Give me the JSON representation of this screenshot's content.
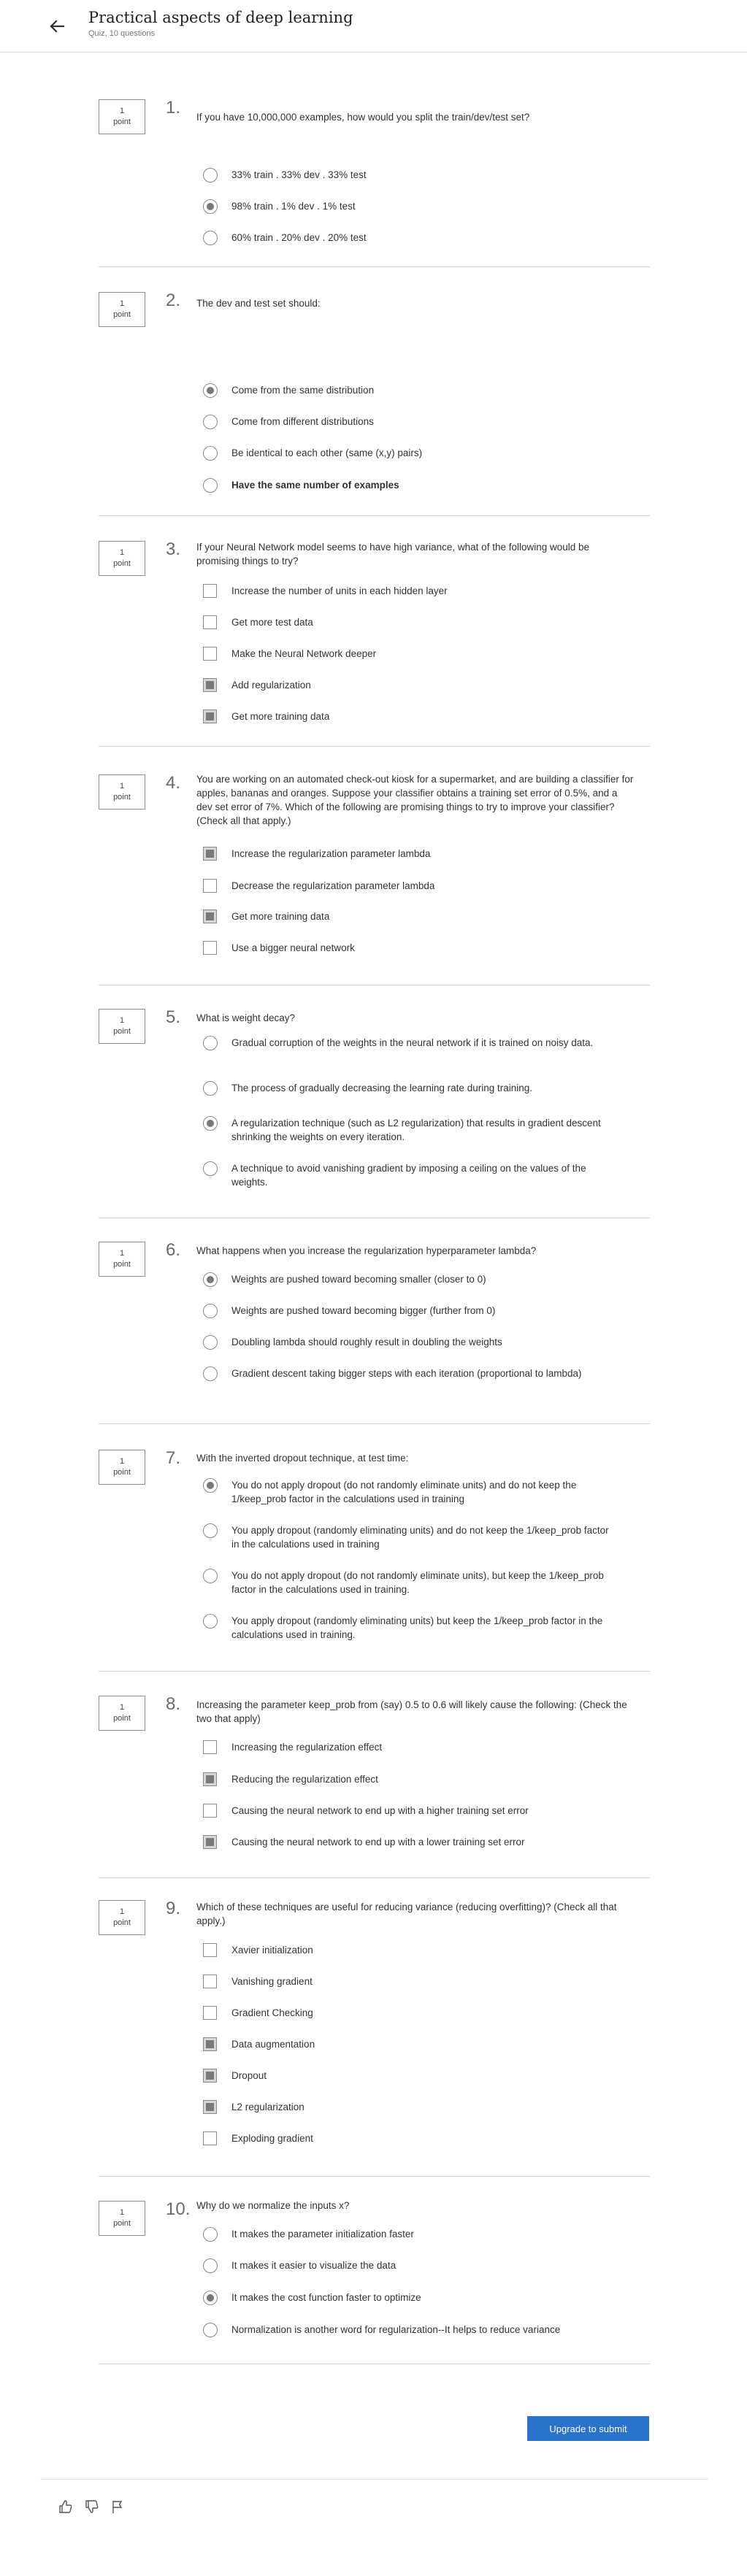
{
  "header": {
    "title": "Practical aspects of deep learning",
    "subtitle": "Quiz, 10 questions"
  },
  "points_label": {
    "value": "1",
    "unit": "point"
  },
  "questions": [
    {
      "number": "1.",
      "type": "radio",
      "text": "If you have 10,000,000 examples, how would you split the train/dev/test set?",
      "options": [
        {
          "label": "33% train . 33% dev . 33% test",
          "selected": false
        },
        {
          "label": "98% train . 1% dev . 1% test",
          "selected": true
        },
        {
          "label": "60% train . 20% dev . 20% test",
          "selected": false
        }
      ]
    },
    {
      "number": "2.",
      "type": "radio",
      "text": "The dev and test set should:",
      "options": [
        {
          "label": "Come from the same distribution",
          "selected": true
        },
        {
          "label": "Come from different distributions",
          "selected": false
        },
        {
          "label": "Be identical to each other (same (x,y) pairs)",
          "selected": false
        },
        {
          "label": "Have the same number of examples",
          "selected": false
        }
      ]
    },
    {
      "number": "3.",
      "type": "checkbox",
      "text": "If your Neural Network model seems to have high variance, what of the following would be promising things to try?",
      "options": [
        {
          "label": "Increase the number of units in each hidden layer",
          "selected": false
        },
        {
          "label": "Get more test data",
          "selected": false
        },
        {
          "label": "Make the Neural Network deeper",
          "selected": false
        },
        {
          "label": "Add regularization",
          "selected": true
        },
        {
          "label": "Get more training data",
          "selected": true
        }
      ]
    },
    {
      "number": "4.",
      "type": "checkbox",
      "text": "You are working on an automated check-out kiosk for a supermarket, and are building a classifier for apples, bananas and oranges. Suppose your classifier obtains a training set error of 0.5%, and a dev set error of 7%. Which of the following are promising things to try to improve your classifier? (Check all that apply.)",
      "options": [
        {
          "label": "Increase the regularization parameter lambda",
          "selected": true
        },
        {
          "label": "Decrease the regularization parameter lambda",
          "selected": false
        },
        {
          "label": "Get more training data",
          "selected": true
        },
        {
          "label": "Use a bigger neural network",
          "selected": false
        }
      ]
    },
    {
      "number": "5.",
      "type": "radio",
      "text": "What is weight decay?",
      "options": [
        {
          "label": "Gradual corruption of the weights in the neural network if it is trained on noisy data.",
          "selected": false
        },
        {
          "label": "The process of gradually decreasing the learning rate during training.",
          "selected": false
        },
        {
          "label": "A regularization technique (such as L2 regularization) that results in gradient descent shrinking the weights on every iteration.",
          "selected": true
        },
        {
          "label": "A technique to avoid vanishing gradient by imposing a ceiling on the values of the weights.",
          "selected": false
        }
      ]
    },
    {
      "number": "6.",
      "type": "radio",
      "text": "What happens when you increase the regularization hyperparameter lambda?",
      "options": [
        {
          "label": "Weights are pushed toward becoming smaller (closer to 0)",
          "selected": true
        },
        {
          "label": "Weights are pushed toward becoming bigger (further from 0)",
          "selected": false
        },
        {
          "label": "Doubling lambda should roughly result in doubling the weights",
          "selected": false
        },
        {
          "label": "Gradient descent taking bigger steps with each iteration (proportional to lambda)",
          "selected": false
        }
      ]
    },
    {
      "number": "7.",
      "type": "radio",
      "text": "With the inverted dropout technique, at test time:",
      "options": [
        {
          "label": "You do not apply dropout (do not randomly eliminate units) and do not keep the 1/keep_prob factor in the calculations used in training",
          "selected": true
        },
        {
          "label": "You apply dropout (randomly eliminating units) and do not keep the 1/keep_prob factor in the calculations used in training",
          "selected": false
        },
        {
          "label": "You do not apply dropout (do not randomly eliminate units), but keep the 1/keep_prob factor in the calculations used in training.",
          "selected": false
        },
        {
          "label": "You apply dropout (randomly eliminating units) but keep the 1/keep_prob factor in the calculations used in training.",
          "selected": false
        }
      ]
    },
    {
      "number": "8.",
      "type": "checkbox",
      "text": "Increasing the parameter keep_prob from (say) 0.5 to 0.6 will likely cause the following: (Check the two that apply)",
      "options": [
        {
          "label": "Increasing the regularization effect",
          "selected": false
        },
        {
          "label": "Reducing the regularization effect",
          "selected": true
        },
        {
          "label": "Causing the neural network to end up with a higher training set error",
          "selected": false
        },
        {
          "label": "Causing the neural network to end up with a lower training set error",
          "selected": true
        }
      ]
    },
    {
      "number": "9.",
      "type": "checkbox",
      "text": "Which of these techniques are useful for reducing variance (reducing overfitting)? (Check all that apply.)",
      "options": [
        {
          "label": "Xavier initialization",
          "selected": false
        },
        {
          "label": "Vanishing gradient",
          "selected": false
        },
        {
          "label": "Gradient Checking",
          "selected": false
        },
        {
          "label": "Data augmentation",
          "selected": true
        },
        {
          "label": "Dropout",
          "selected": true
        },
        {
          "label": "L2 regularization",
          "selected": true
        },
        {
          "label": "Exploding gradient",
          "selected": false
        }
      ]
    },
    {
      "number": "10.",
      "type": "radio",
      "text": "Why do we normalize the inputs x?",
      "options": [
        {
          "label": "It makes the parameter initialization faster",
          "selected": false
        },
        {
          "label": "It makes it easier to visualize the data",
          "selected": false
        },
        {
          "label": "It makes the cost function faster to optimize",
          "selected": true
        },
        {
          "label": "Normalization is another word for regularization--It helps to reduce variance",
          "selected": false
        }
      ]
    }
  ],
  "submit": {
    "label": "Upgrade to submit"
  },
  "footer": {
    "icons": [
      "thumbs-up-icon",
      "thumbs-down-icon",
      "flag-icon"
    ]
  }
}
